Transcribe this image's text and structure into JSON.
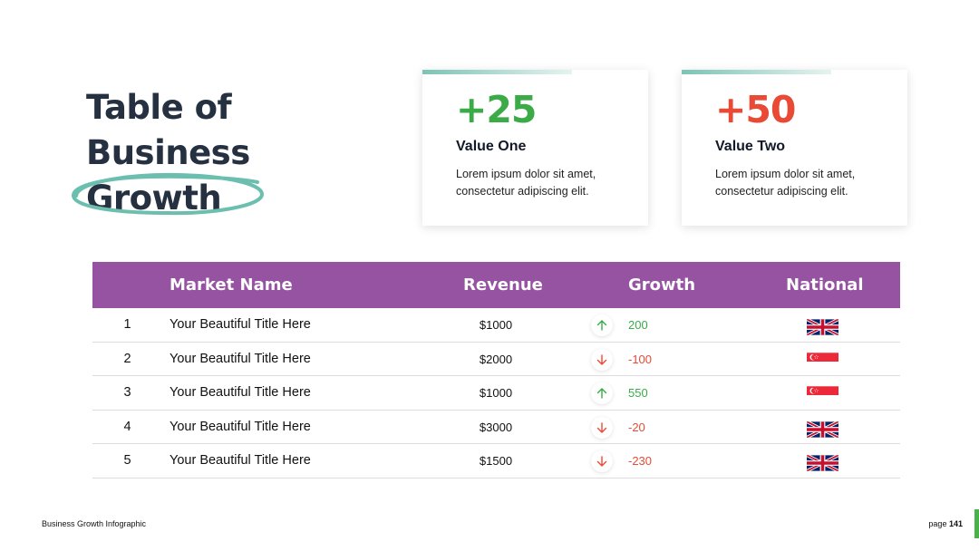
{
  "title": {
    "line1": "Table of",
    "line2": "Business",
    "line3": "Growth"
  },
  "cards": [
    {
      "value": "+25",
      "label": "Value One",
      "text": "Lorem ipsum dolor sit amet, consectetur adipiscing elit.",
      "color": "#3bab48"
    },
    {
      "value": "+50",
      "label": "Value Two",
      "text": "Lorem ipsum dolor sit amet, consectetur adipiscing elit.",
      "color": "#e84a36"
    }
  ],
  "table": {
    "headers": {
      "market": "Market Name",
      "revenue": "Revenue",
      "growth": "Growth",
      "national": "National"
    },
    "rows": [
      {
        "num": "1",
        "name": "Your Beautiful Title Here",
        "revenue": "$1000",
        "growth": "200",
        "direction": "up",
        "flag": "uk"
      },
      {
        "num": "2",
        "name": "Your Beautiful Title Here",
        "revenue": "$2000",
        "growth": "-100",
        "direction": "down",
        "flag": "singapore"
      },
      {
        "num": "3",
        "name": "Your Beautiful Title Here",
        "revenue": "$1000",
        "growth": "550",
        "direction": "up",
        "flag": "singapore"
      },
      {
        "num": "4",
        "name": "Your Beautiful Title Here",
        "revenue": "$3000",
        "growth": "-20",
        "direction": "down",
        "flag": "uk"
      },
      {
        "num": "5",
        "name": "Your Beautiful Title Here",
        "revenue": "$1500",
        "growth": "-230",
        "direction": "down",
        "flag": "uk"
      }
    ]
  },
  "colors": {
    "header_bg": "#9653a2",
    "up": "#3bab48",
    "down": "#e84a36",
    "accent": "#6cbfae",
    "title": "#253041"
  },
  "footer": {
    "left": "Business Growth Infographic",
    "page_prefix": "page",
    "page_number": "141"
  }
}
